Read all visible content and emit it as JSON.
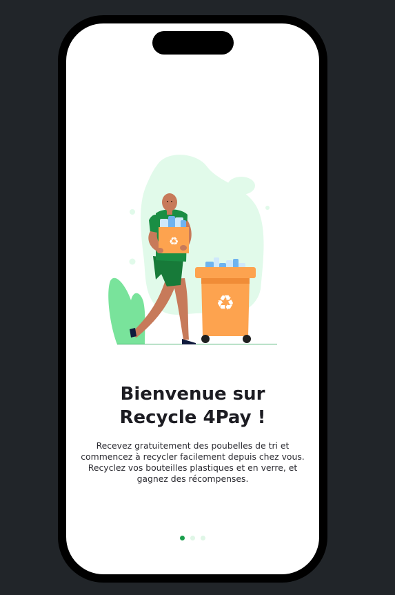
{
  "onboarding": {
    "title_line1": "Bienvenue sur",
    "title_line2": "Recycle 4Pay !",
    "description_lines": [
      "Recevez gratuitement des poubelles de tri et",
      "commencez à recycler facilement depuis chez vous.",
      "Recyclez vos bouteilles plastiques et en verre, et",
      "gagnez des récompenses."
    ],
    "pager": {
      "total": 3,
      "active": 1
    },
    "illustration": "person-carrying-recycling-box-to-orange-bin"
  },
  "colors": {
    "accent_green": "#1a9e4c",
    "inactive_dot": "#dff6e6",
    "bin_orange": "#fda34f",
    "blob_mint": "#e1faea",
    "background": "#212529"
  }
}
